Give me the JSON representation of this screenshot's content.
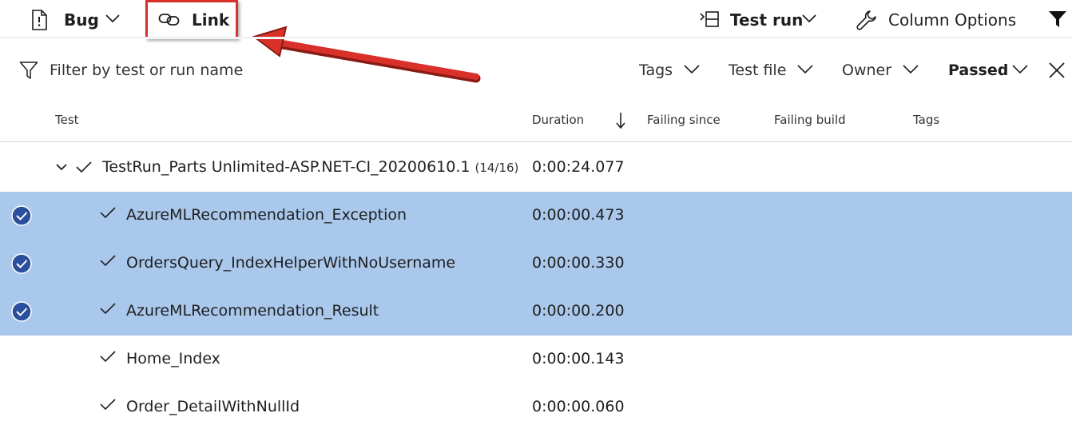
{
  "toolbar": {
    "bug_label": "Bug",
    "link_label": "Link",
    "test_run_label": "Test run",
    "column_options_label": "Column Options"
  },
  "filters": {
    "search_placeholder": "Filter by test or run name",
    "tags_label": "Tags",
    "test_file_label": "Test file",
    "owner_label": "Owner",
    "outcome_label": "Passed"
  },
  "columns": {
    "test": "Test",
    "duration": "Duration",
    "failing_since": "Failing since",
    "failing_build": "Failing build",
    "tags": "Tags"
  },
  "run": {
    "name": "TestRun_Parts Unlimited-ASP.NET-CI_20200610.1",
    "count": "(14/16)",
    "duration": "0:00:24.077"
  },
  "rows": [
    {
      "name": "AzureMLRecommendation_Exception",
      "duration": "0:00:00.473",
      "selected": true
    },
    {
      "name": "OrdersQuery_IndexHelperWithNoUsername",
      "duration": "0:00:00.330",
      "selected": true
    },
    {
      "name": "AzureMLRecommendation_Result",
      "duration": "0:00:00.200",
      "selected": true
    },
    {
      "name": "Home_Index",
      "duration": "0:00:00.143",
      "selected": false
    },
    {
      "name": "Order_DetailWithNullId",
      "duration": "0:00:00.060",
      "selected": false
    }
  ],
  "colors": {
    "selected_row": "#a9c8ec",
    "selection_circle": "#2b4f9e",
    "highlight_box": "#d9302a",
    "annotation_arrow": "#d9302a"
  },
  "icons": {
    "bug": "bug-report-icon",
    "link": "link-icon",
    "test_run": "group-by-icon",
    "column_options": "wrench-icon",
    "filter_toolbar": "filter-funnel-filled-icon",
    "filter_search": "filter-funnel-outline-icon",
    "close": "close-icon",
    "sort": "sort-down-arrow-icon"
  }
}
